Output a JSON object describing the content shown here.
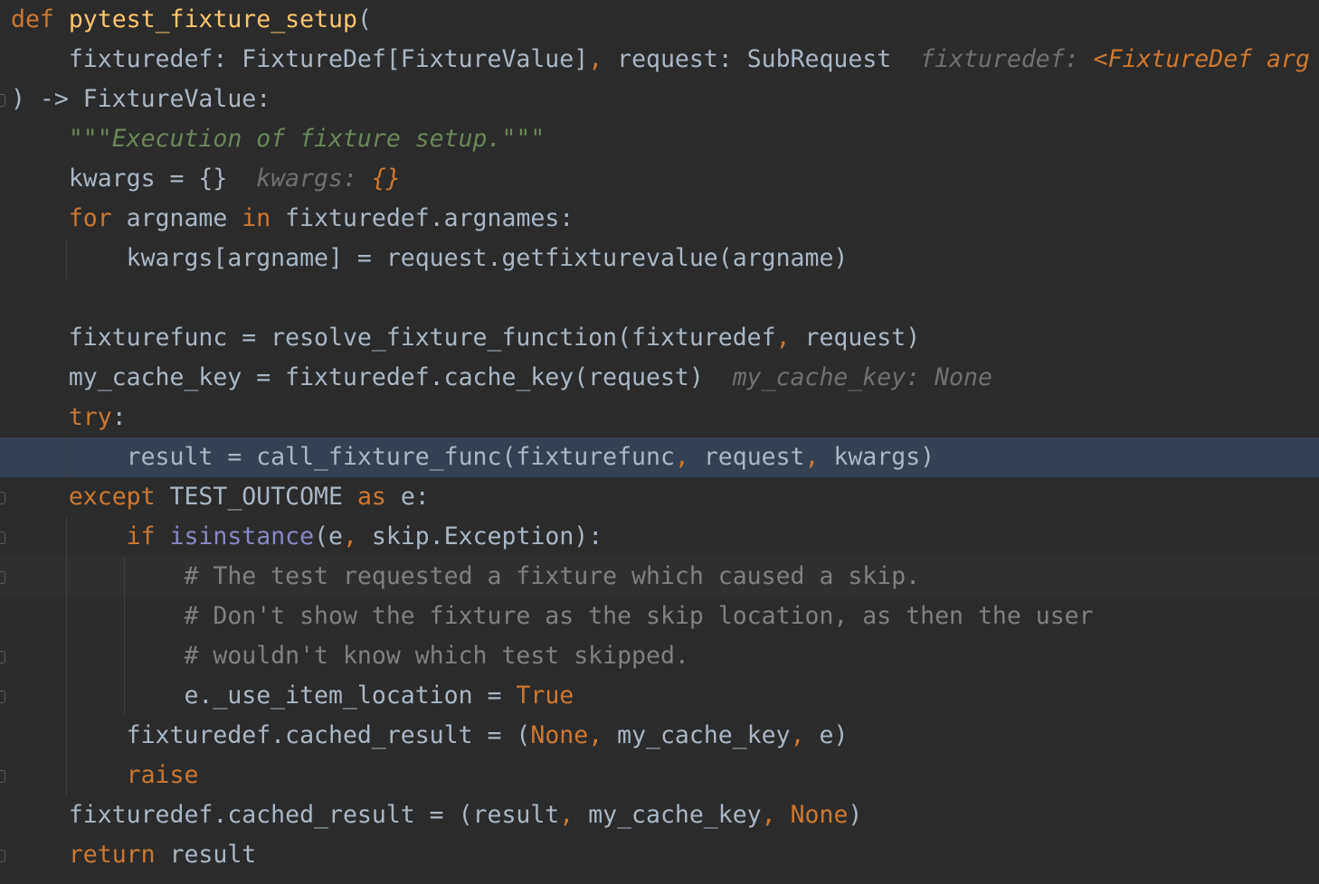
{
  "editor": {
    "lines": [
      {
        "segments": [
          {
            "t": "def",
            "c": "kw"
          },
          {
            "t": " "
          },
          {
            "t": "pytest_fixture_setup",
            "c": "fn"
          },
          {
            "t": "("
          }
        ]
      },
      {
        "segments": [
          {
            "t": "    fixturedef: FixtureDef[FixtureValue]"
          },
          {
            "t": ",",
            "c": "comma"
          },
          {
            "t": " request: SubRequest  "
          },
          {
            "t": "fixturedef: ",
            "c": "hint"
          },
          {
            "t": "<FixtureDef arg",
            "c": "hintv"
          }
        ]
      },
      {
        "segments": [
          {
            "t": ") -> FixtureValue:"
          }
        ]
      },
      {
        "segments": [
          {
            "t": "    "
          },
          {
            "t": "\"\"\"Execution of fixture setup.\"\"\"",
            "c": "str"
          }
        ]
      },
      {
        "segments": [
          {
            "t": "    kwargs = {}  "
          },
          {
            "t": "kwargs: ",
            "c": "hint"
          },
          {
            "t": "{}",
            "c": "hintv"
          }
        ]
      },
      {
        "segments": [
          {
            "t": "    "
          },
          {
            "t": "for",
            "c": "kw"
          },
          {
            "t": " argname "
          },
          {
            "t": "in",
            "c": "kw"
          },
          {
            "t": " fixturedef.argnames:"
          }
        ]
      },
      {
        "segments": [
          {
            "t": "        kwargs[argname] = request.getfixturevalue(argname)"
          }
        ]
      },
      {
        "segments": [
          {
            "t": ""
          }
        ]
      },
      {
        "segments": [
          {
            "t": "    fixturefunc = resolve_fixture_function(fixturedef"
          },
          {
            "t": ",",
            "c": "comma"
          },
          {
            "t": " request)"
          }
        ]
      },
      {
        "segments": [
          {
            "t": "    my_cache_key = fixturedef.cache_key(request)  "
          },
          {
            "t": "my_cache_key: None",
            "c": "hintn"
          }
        ]
      },
      {
        "segments": [
          {
            "t": "    "
          },
          {
            "t": "try",
            "c": "kw"
          },
          {
            "t": ":"
          }
        ]
      },
      {
        "segments": [
          {
            "t": "        result = call_fixture_func(fixturefunc"
          },
          {
            "t": ",",
            "c": "comma"
          },
          {
            "t": " request"
          },
          {
            "t": ",",
            "c": "comma"
          },
          {
            "t": " kwargs)"
          }
        ],
        "highlight": true
      },
      {
        "segments": [
          {
            "t": "    "
          },
          {
            "t": "except",
            "c": "kw"
          },
          {
            "t": " TEST_OUTCOME "
          },
          {
            "t": "as",
            "c": "kw"
          },
          {
            "t": " e:"
          }
        ]
      },
      {
        "segments": [
          {
            "t": "        "
          },
          {
            "t": "if",
            "c": "kw"
          },
          {
            "t": " "
          },
          {
            "t": "isinstance",
            "c": "bi"
          },
          {
            "t": "(e"
          },
          {
            "t": ",",
            "c": "comma"
          },
          {
            "t": " skip.Exception):"
          }
        ]
      },
      {
        "segments": [
          {
            "t": "            "
          },
          {
            "t": "# The test requested a fixture which caused a skip.",
            "c": "cmt"
          }
        ],
        "hover": true
      },
      {
        "segments": [
          {
            "t": "            "
          },
          {
            "t": "# Don't show the fixture as the skip location, as then the user",
            "c": "cmt"
          }
        ]
      },
      {
        "segments": [
          {
            "t": "            "
          },
          {
            "t": "# wouldn't know which test skipped.",
            "c": "cmt"
          }
        ]
      },
      {
        "segments": [
          {
            "t": "            e._use_item_location = "
          },
          {
            "t": "True",
            "c": "kw"
          }
        ]
      },
      {
        "segments": [
          {
            "t": "        fixturedef.cached_result = ("
          },
          {
            "t": "None",
            "c": "kw"
          },
          {
            "t": ",",
            "c": "comma"
          },
          {
            "t": " my_cache_key"
          },
          {
            "t": ",",
            "c": "comma"
          },
          {
            "t": " e)"
          }
        ]
      },
      {
        "segments": [
          {
            "t": "        "
          },
          {
            "t": "raise",
            "c": "kw"
          }
        ]
      },
      {
        "segments": [
          {
            "t": "    fixturedef.cached_result = (result"
          },
          {
            "t": ",",
            "c": "comma"
          },
          {
            "t": " my_cache_key"
          },
          {
            "t": ",",
            "c": "comma"
          },
          {
            "t": " "
          },
          {
            "t": "None",
            "c": "kw"
          },
          {
            "t": ")"
          }
        ]
      },
      {
        "segments": [
          {
            "t": "    "
          },
          {
            "t": "return",
            "c": "kw"
          },
          {
            "t": " result"
          }
        ]
      }
    ]
  },
  "colors": {
    "background": "#2b2b2b",
    "text": "#a9b7c6",
    "keyword": "#cc7832",
    "function": "#ffc66d",
    "string": "#6a8759",
    "comment": "#808080",
    "builtin": "#8888c6",
    "hint": "#707070",
    "caret_line_highlight": "#344152"
  }
}
